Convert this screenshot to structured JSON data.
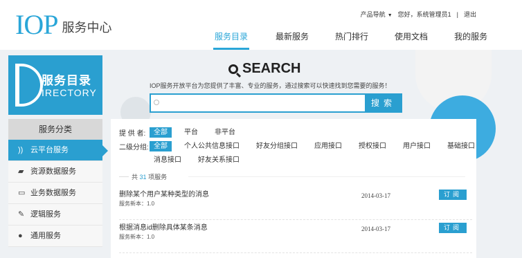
{
  "header": {
    "logo_main": "IOP",
    "logo_sub": "服务中心",
    "product_nav": "产品导航",
    "greeting": "您好，系统管理员1",
    "separator": "|",
    "logout": "退出",
    "nav": [
      {
        "label": "服务目录",
        "active": true
      },
      {
        "label": "最新服务",
        "active": false
      },
      {
        "label": "热门排行",
        "active": false
      },
      {
        "label": "使用文档",
        "active": false
      },
      {
        "label": "我的服务",
        "active": false
      }
    ]
  },
  "sidebar": {
    "directory_title": "服务目录",
    "directory_sub": "IRECTORY",
    "category_header": "服务分类",
    "items": [
      {
        "label": "云平台服务",
        "icon": "rss-icon",
        "active": true
      },
      {
        "label": "资源数据服务",
        "icon": "edit-icon",
        "active": false
      },
      {
        "label": "业务数据服务",
        "icon": "monitor-icon",
        "active": false
      },
      {
        "label": "逻辑服务",
        "icon": "pencil-icon",
        "active": false
      },
      {
        "label": "通用服务",
        "icon": "chat-icon",
        "active": false
      }
    ]
  },
  "search": {
    "title": "SEARCH",
    "description": "IOP服务开放平台为您提供了丰富、专业的服务，通过搜索可以快速找到您需要的服务！",
    "placeholder": "",
    "button": "搜索"
  },
  "filters": {
    "provider_label": "提 供 者:",
    "provider_tags": [
      "全部",
      "平台",
      "非平台"
    ],
    "group_label": "二级分组:",
    "group_tags": [
      "全部",
      "个人公共信息接口",
      "好友分组接口",
      "应用接口",
      "授权接口",
      "用户接口",
      "基础接口"
    ],
    "group_tags_row2": [
      "消息接口",
      "好友关系接口"
    ]
  },
  "results": {
    "total_prefix": "共",
    "total_count": "31",
    "total_suffix": "项服务",
    "services": [
      {
        "name": "删除某个用户某种类型的消息",
        "version": "服务新本：1.0",
        "date": "2014-03-17",
        "action": "订阅"
      },
      {
        "name": "根据消息id删除具体某条消息",
        "version": "服务新本：1.0",
        "date": "2014-03-17",
        "action": "订阅"
      }
    ]
  },
  "colors": {
    "accent": "#2a9fd0"
  }
}
